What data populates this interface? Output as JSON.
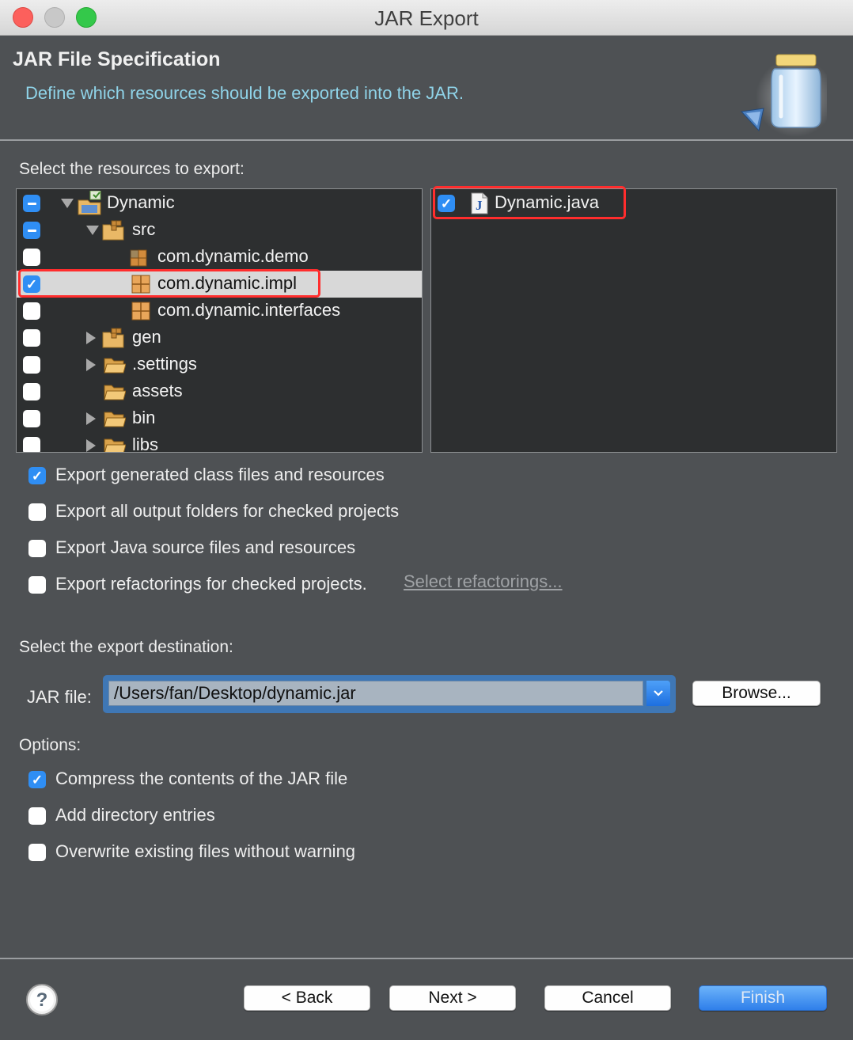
{
  "window": {
    "title": "JAR Export"
  },
  "header": {
    "title": "JAR File Specification",
    "description": "Define which resources should be exported into the JAR.",
    "icon": "jar-icon"
  },
  "resources": {
    "label": "Select the resources to export:",
    "tree": [
      {
        "label": "Dynamic",
        "state": "partial",
        "expanded": true,
        "icon": "java-project-icon"
      },
      {
        "label": "src",
        "state": "partial",
        "expanded": true,
        "icon": "source-folder-icon"
      },
      {
        "label": "com.dynamic.demo",
        "state": "unchecked",
        "icon": "package-icon"
      },
      {
        "label": "com.dynamic.impl",
        "state": "checked",
        "selected": true,
        "icon": "package-icon"
      },
      {
        "label": "com.dynamic.interfaces",
        "state": "unchecked",
        "icon": "package-icon"
      },
      {
        "label": "gen",
        "state": "unchecked",
        "expanded": false,
        "icon": "source-folder-icon"
      },
      {
        "label": ".settings",
        "state": "unchecked",
        "expanded": false,
        "icon": "folder-icon"
      },
      {
        "label": "assets",
        "state": "unchecked",
        "icon": "folder-icon"
      },
      {
        "label": "bin",
        "state": "unchecked",
        "expanded": false,
        "icon": "folder-icon"
      },
      {
        "label": "libs",
        "state": "unchecked",
        "expanded": false,
        "icon": "folder-icon"
      }
    ],
    "files": [
      {
        "label": "Dynamic.java",
        "state": "checked",
        "icon": "java-file-icon"
      }
    ]
  },
  "export_options": [
    {
      "label": "Export generated class files and resources",
      "checked": true
    },
    {
      "label": "Export all output folders for checked projects",
      "checked": false
    },
    {
      "label": "Export Java source files and resources",
      "checked": false
    },
    {
      "label": "Export refactorings for checked projects.",
      "checked": false
    }
  ],
  "refactor_link": "Select refactorings...",
  "destination": {
    "label": "Select the export destination:",
    "jar_label": "JAR file:",
    "jar_value": "/Users/fan/Desktop/dynamic.jar",
    "browse_label": "Browse..."
  },
  "options": {
    "label": "Options:",
    "items": [
      {
        "label": "Compress the contents of the JAR file",
        "checked": true
      },
      {
        "label": "Add directory entries",
        "checked": false
      },
      {
        "label": "Overwrite existing files without warning",
        "checked": false
      }
    ]
  },
  "buttons": {
    "back": "< Back",
    "next": "Next >",
    "cancel": "Cancel",
    "finish": "Finish"
  },
  "colors": {
    "highlight": "#ff2d2d",
    "accent": "#2f8ef4",
    "header_desc": "#8fd3e8"
  }
}
